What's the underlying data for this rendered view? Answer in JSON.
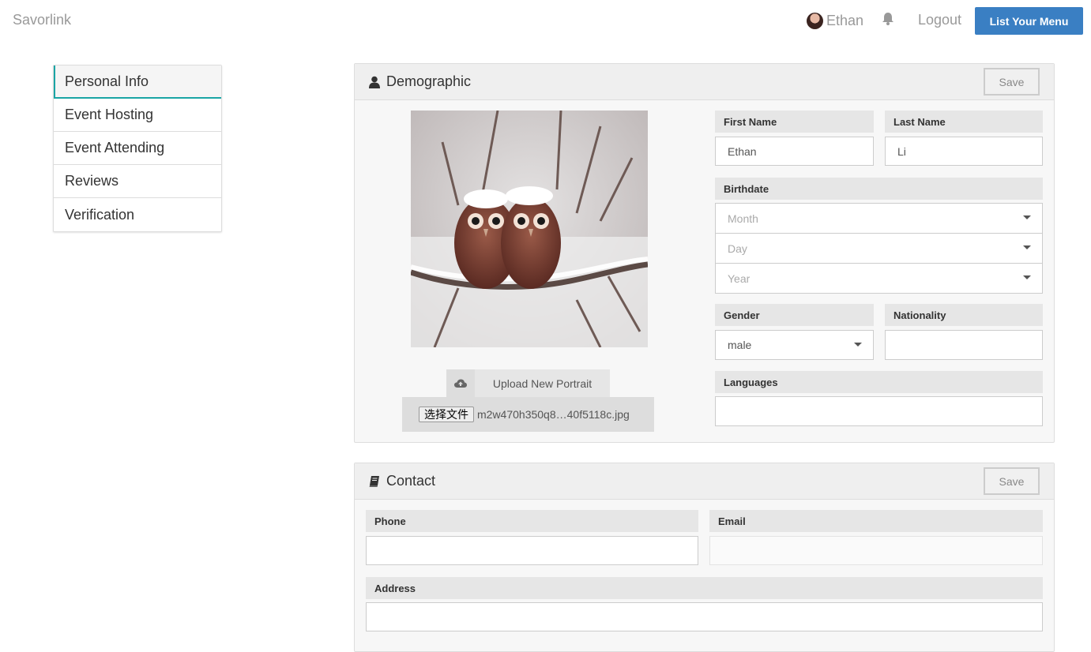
{
  "nav": {
    "brand": "Savorlink",
    "user_name": "Ethan",
    "logout": "Logout",
    "list_menu": "List Your Menu"
  },
  "side_menu": {
    "items": [
      {
        "label": "Personal Info",
        "active": true
      },
      {
        "label": "Event Hosting"
      },
      {
        "label": "Event Attending"
      },
      {
        "label": "Reviews"
      },
      {
        "label": "Verification"
      }
    ]
  },
  "demographic": {
    "title": "Demographic",
    "save": "Save",
    "upload_label": "Upload New Portrait",
    "file_button": "选择文件",
    "file_name": "m2w470h350q8…40f5118c.jpg",
    "first_name": {
      "label": "First Name",
      "value": "Ethan"
    },
    "last_name": {
      "label": "Last Name",
      "value": "Li"
    },
    "birthdate": {
      "label": "Birthdate",
      "month": "Month",
      "day": "Day",
      "year": "Year"
    },
    "gender": {
      "label": "Gender",
      "value": "male"
    },
    "nationality": {
      "label": "Nationality",
      "value": ""
    },
    "languages": {
      "label": "Languages",
      "value": ""
    }
  },
  "contact": {
    "title": "Contact",
    "save": "Save",
    "phone": {
      "label": "Phone",
      "value": ""
    },
    "email": {
      "label": "Email",
      "value": ""
    },
    "address": {
      "label": "Address",
      "value": ""
    }
  },
  "colors": {
    "accent": "#3a7fc3",
    "active_tab": "#1aa5a5"
  }
}
